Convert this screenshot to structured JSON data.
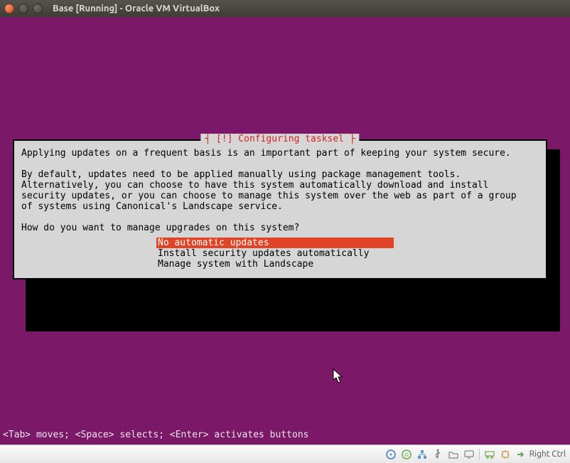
{
  "window": {
    "title": "Base [Running] - Oracle VM VirtualBox"
  },
  "dialog": {
    "title_decor": "┤ [!] Configuring tasksel ├",
    "body": "Applying updates on a frequent basis is an important part of keeping your system secure.\n\nBy default, updates need to be applied manually using package management tools.\nAlternatively, you can choose to have this system automatically download and install\nsecurity updates, or you can choose to manage this system over the web as part of a group\nof systems using Canonical's Landscape service.\n\nHow do you want to manage upgrades on this system?",
    "options": [
      {
        "label": "No automatic updates",
        "selected": true
      },
      {
        "label": "Install security updates automatically",
        "selected": false
      },
      {
        "label": "Manage system with Landscape",
        "selected": false
      }
    ]
  },
  "hint": "<Tab> moves; <Space> selects; <Enter> activates buttons",
  "statusbar": {
    "host_key": "Right Ctrl",
    "icons": [
      "harddisk-icon",
      "optical-icon",
      "network-icon",
      "usb-icon",
      "shared-folder-icon",
      "display-icon",
      "recording-icon",
      "cpu-icon"
    ]
  }
}
